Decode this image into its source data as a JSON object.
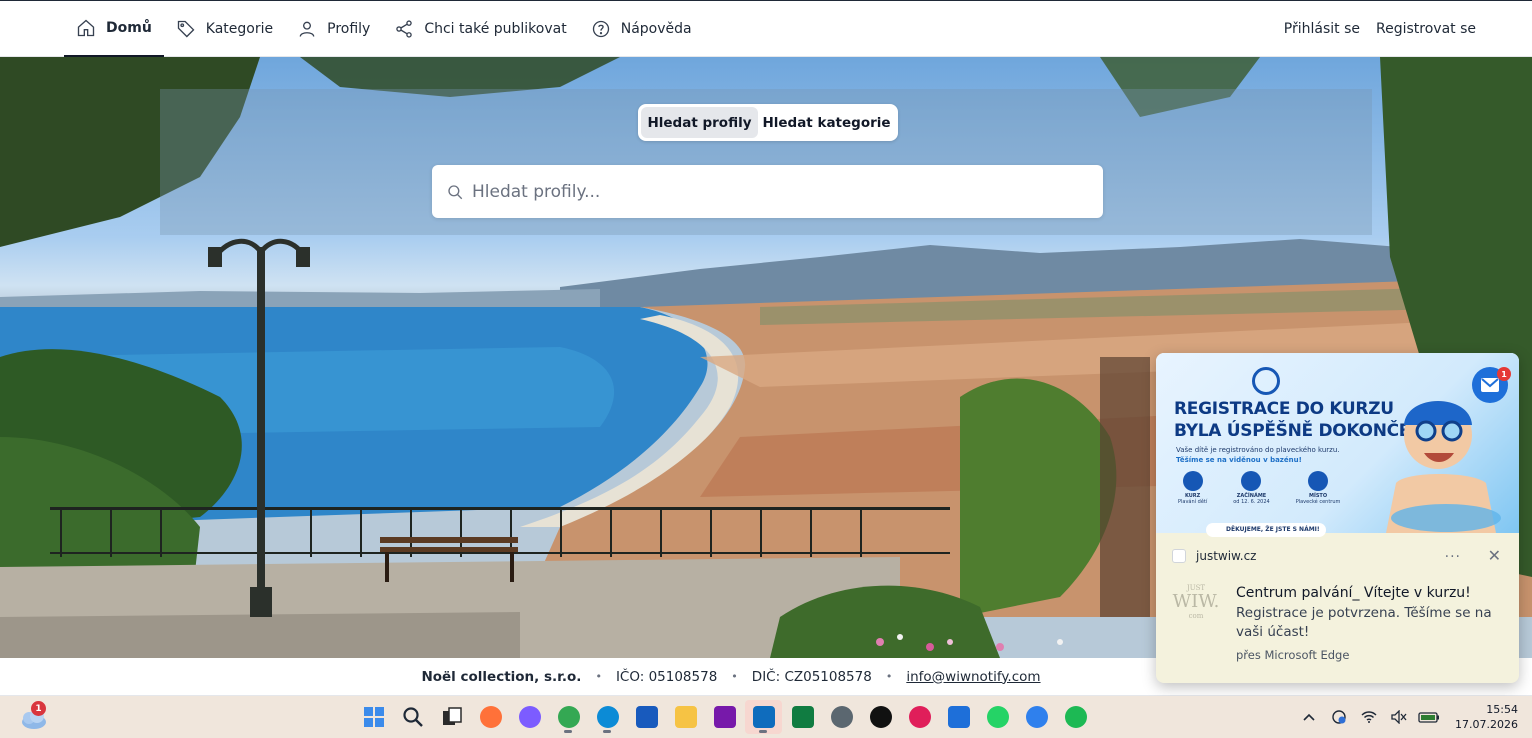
{
  "nav": {
    "items": [
      {
        "label": "Domů",
        "icon": "home-icon",
        "active": true
      },
      {
        "label": "Kategorie",
        "icon": "tag-icon",
        "active": false
      },
      {
        "label": "Profily",
        "icon": "user-icon",
        "active": false
      },
      {
        "label": "Chci také publikovat",
        "icon": "share-icon",
        "active": false
      },
      {
        "label": "Nápověda",
        "icon": "help-icon",
        "active": false
      }
    ],
    "login": "Přihlásit se",
    "register": "Registrovat se"
  },
  "hero": {
    "toggle": {
      "profiles": "Hledat profily",
      "categories": "Hledat kategorie"
    },
    "search_placeholder": "Hledat profily..."
  },
  "footer": {
    "company": "Noël collection, s.r.o.",
    "ico": "IČO: 05108578",
    "dic": "DIČ: CZ05108578",
    "email": "info@wiwnotify.com",
    "separator": "•"
  },
  "notification": {
    "banner": {
      "title_line1": "REGISTRACE DO KURZU",
      "title_line2": "BYLA ÚSPĚŠNĚ DOKONČENA!",
      "subtitle": "Vaše dítě je registrováno do plaveckého kurzu.",
      "subtitle_highlight": "Těšíme se na viděnou v bazénu!",
      "icons": [
        {
          "label": "KURZ",
          "sub": "Plavání dětí"
        },
        {
          "label": "ZAČÍNÁME",
          "sub": "od 12. 6. 2024"
        },
        {
          "label": "MÍSTO",
          "sub": "Plavecké centrum"
        }
      ],
      "pill": "DĚKUJEME, ŽE JSTE S NÁMI!",
      "mail_badge": "1"
    },
    "site": "justwiw.cz",
    "more": "···",
    "close": "✕",
    "logo_top": "JUST",
    "logo_main": "WIW.",
    "logo_bottom": "com",
    "title": "Centrum palvání_ Vítejte v kurzu!",
    "body": "Registrace je potvrzena. Těšíme se na vaši účast!",
    "via": "přes Microsoft Edge"
  },
  "taskbar": {
    "weather_badge": "1",
    "apps": [
      {
        "name": "start-icon",
        "color": "#1a73e8"
      },
      {
        "name": "search-icon",
        "color": "#1f2937"
      },
      {
        "name": "task-view-icon",
        "color": "#1f2937"
      },
      {
        "name": "firefox-icon",
        "color": "#ff7139"
      },
      {
        "name": "copilot-icon",
        "color": "#7c5cff"
      },
      {
        "name": "chrome-icon",
        "color": "#34a853"
      },
      {
        "name": "edge-icon",
        "color": "#0c8bd6"
      },
      {
        "name": "word-icon",
        "color": "#185abd"
      },
      {
        "name": "explorer-icon",
        "color": "#f6c344"
      },
      {
        "name": "onenote-icon",
        "color": "#7719aa"
      },
      {
        "name": "outlook-icon",
        "color": "#0f6cbd"
      },
      {
        "name": "excel-icon",
        "color": "#107c41"
      },
      {
        "name": "settings-icon",
        "color": "#5b6770"
      },
      {
        "name": "chatgpt-icon",
        "color": "#111111"
      },
      {
        "name": "slack-icon",
        "color": "#e01e5a"
      },
      {
        "name": "outlook-new-icon",
        "color": "#1e6fd9"
      },
      {
        "name": "whatsapp-icon",
        "color": "#25d366"
      },
      {
        "name": "maps-icon",
        "color": "#2f80ed"
      },
      {
        "name": "spotify-icon",
        "color": "#1db954"
      }
    ],
    "time": "15:54",
    "date": "17.07.2026"
  }
}
